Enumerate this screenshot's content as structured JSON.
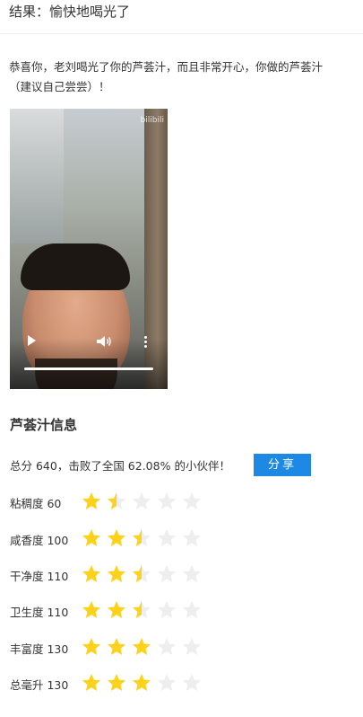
{
  "header": {
    "result_text": "结果：愉快地喝光了"
  },
  "message": {
    "line1": "恭喜你，老刘喝光了你的芦荟汁，而且非常开心，你做的芦荟汁",
    "line2": "（建议自己尝尝）！"
  },
  "video": {
    "watermark": "bilibili"
  },
  "info": {
    "title": "芦荟汁信息",
    "score_text": "总分 640，击败了全国 62.08% 的小伙伴！",
    "share_label": "分享"
  },
  "ratings": [
    {
      "label": "粘稠度 60",
      "stars": 1.5
    },
    {
      "label": "咸香度 100",
      "stars": 2.5
    },
    {
      "label": "干净度 110",
      "stars": 2.5
    },
    {
      "label": "卫生度 110",
      "stars": 2.5
    },
    {
      "label": "丰富度 130",
      "stars": 3
    },
    {
      "label": "总毫升 130",
      "stars": 3
    }
  ],
  "colors": {
    "star_filled": "#fcd21a",
    "star_empty": "#eeeeee",
    "share_bg": "#1e88e5"
  }
}
